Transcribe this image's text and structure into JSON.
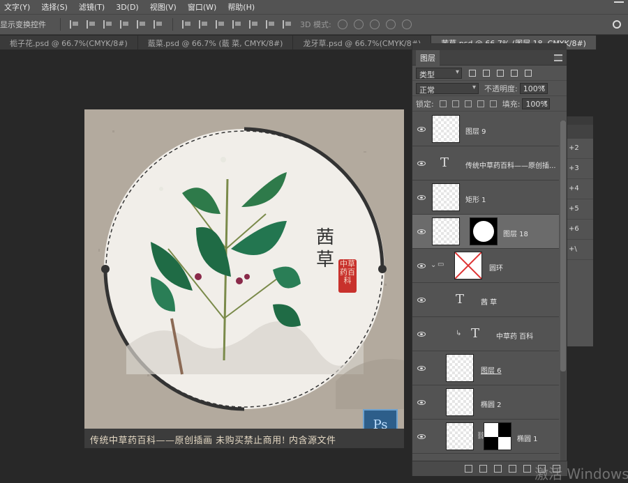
{
  "menu": [
    "文字(Y)",
    "选择(S)",
    "滤镜(T)",
    "3D(D)",
    "视图(V)",
    "窗口(W)",
    "帮助(H)"
  ],
  "options": {
    "transform_label": "显示变换控件",
    "mode3d_label": "3D 模式:"
  },
  "tabs": [
    {
      "label": "栀子花.psd @ 66.7%(CMYK/8#)",
      "active": false
    },
    {
      "label": "蕺菜.psd @ 66.7% (蕺 菜, CMYK/8#)",
      "active": false
    },
    {
      "label": "龙牙草.psd @ 66.7%(CMYK/8#)",
      "active": false
    },
    {
      "label": "茜草.psd @ 66.7% (图层 18, CMYK/8#)",
      "active": true
    }
  ],
  "artwork": {
    "title_chars": [
      "茜",
      "草"
    ],
    "seal_text": "中草药百科",
    "caption": "传统中草药百科——原创插画 未购买禁止商用! 内含源文件",
    "ps_badge": "Ps"
  },
  "layers_panel": {
    "title": "图层",
    "filter_label": "类型",
    "blend_mode": "正常",
    "opacity_label": "不透明度:",
    "opacity_value": "100%",
    "lock_label": "锁定:",
    "fill_label": "填充:",
    "fill_value": "100%",
    "layers": [
      {
        "name": "图层 9",
        "kind": "pixel",
        "selected": false
      },
      {
        "name": "传统中草药百科——原创插...",
        "kind": "text",
        "selected": false
      },
      {
        "name": "矩形 1",
        "kind": "shape",
        "selected": false
      },
      {
        "name": "图层 18",
        "kind": "masked",
        "selected": true
      },
      {
        "name": "圆环",
        "kind": "group",
        "selected": false
      },
      {
        "name": "茜 草",
        "kind": "text",
        "selected": false
      },
      {
        "name": "中草药 百科",
        "kind": "text-clipped",
        "selected": false
      },
      {
        "name": "图层 6",
        "kind": "pixel",
        "selected": false
      },
      {
        "name": "椭圆 2",
        "kind": "shape",
        "selected": false
      },
      {
        "name": "椭圆 1",
        "kind": "shape-masked",
        "selected": false
      }
    ]
  },
  "side_panel": {
    "items": [
      "+2",
      "+3",
      "+4",
      "+5",
      "+6",
      "+\\"
    ]
  },
  "watermark": "激活 Windows",
  "colors": {
    "ui_bg": "#535353",
    "canvas_bg": "#b3aa9e",
    "selected_layer": "#6b6b6b",
    "seal_red": "#c8312c"
  }
}
